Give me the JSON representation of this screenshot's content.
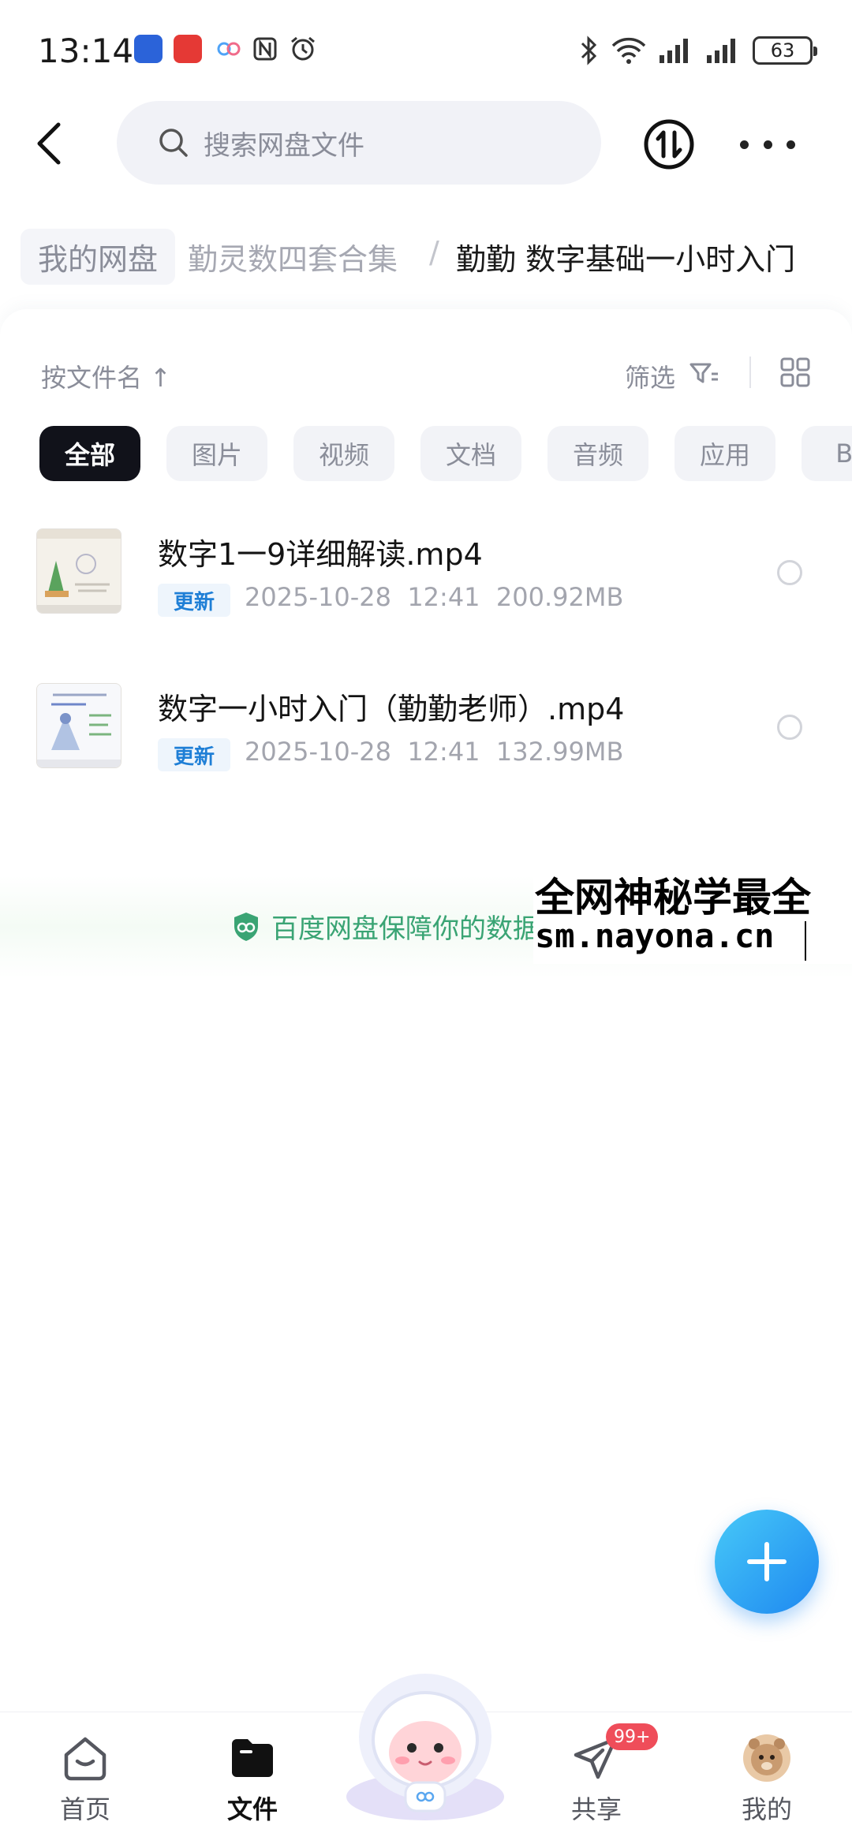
{
  "status_bar": {
    "time": "13:14",
    "battery": "63"
  },
  "search": {
    "placeholder": "搜索网盘文件"
  },
  "breadcrumb": {
    "root": "我的网盘",
    "middle": "勤灵数四套合集",
    "separator": "/",
    "current": "勤勤 数字基础一小时入门"
  },
  "toolbar": {
    "sort_label": "按文件名 ↑",
    "filter_label": "筛选"
  },
  "filters": [
    {
      "label": "全部",
      "active": true
    },
    {
      "label": "图片",
      "active": false
    },
    {
      "label": "视频",
      "active": false
    },
    {
      "label": "文档",
      "active": false
    },
    {
      "label": "音频",
      "active": false
    },
    {
      "label": "应用",
      "active": false
    },
    {
      "label": "BT",
      "active": false
    }
  ],
  "files": [
    {
      "name": "数字1一9详细解读.mp4",
      "tag": "更新",
      "date": "2025-10-28",
      "time": "12:41",
      "size": "200.92MB"
    },
    {
      "name": "数字一小时入门（勤勤老师）.mp4",
      "tag": "更新",
      "date": "2025-10-28",
      "time": "12:41",
      "size": "132.99MB"
    }
  ],
  "security_notice": "百度网盘保障你的数据",
  "watermark": {
    "line1": "全网神秘学最全",
    "line2": "sm.nayona.cn"
  },
  "bottom_nav": {
    "home": "首页",
    "files": "文件",
    "share": "共享",
    "share_badge": "99+",
    "profile": "我的"
  },
  "colors": {
    "accent_blue": "#1e88f0",
    "tag_blue": "#1f7fd6",
    "security_green": "#3aa474",
    "badge_red": "#ef4d5a"
  }
}
